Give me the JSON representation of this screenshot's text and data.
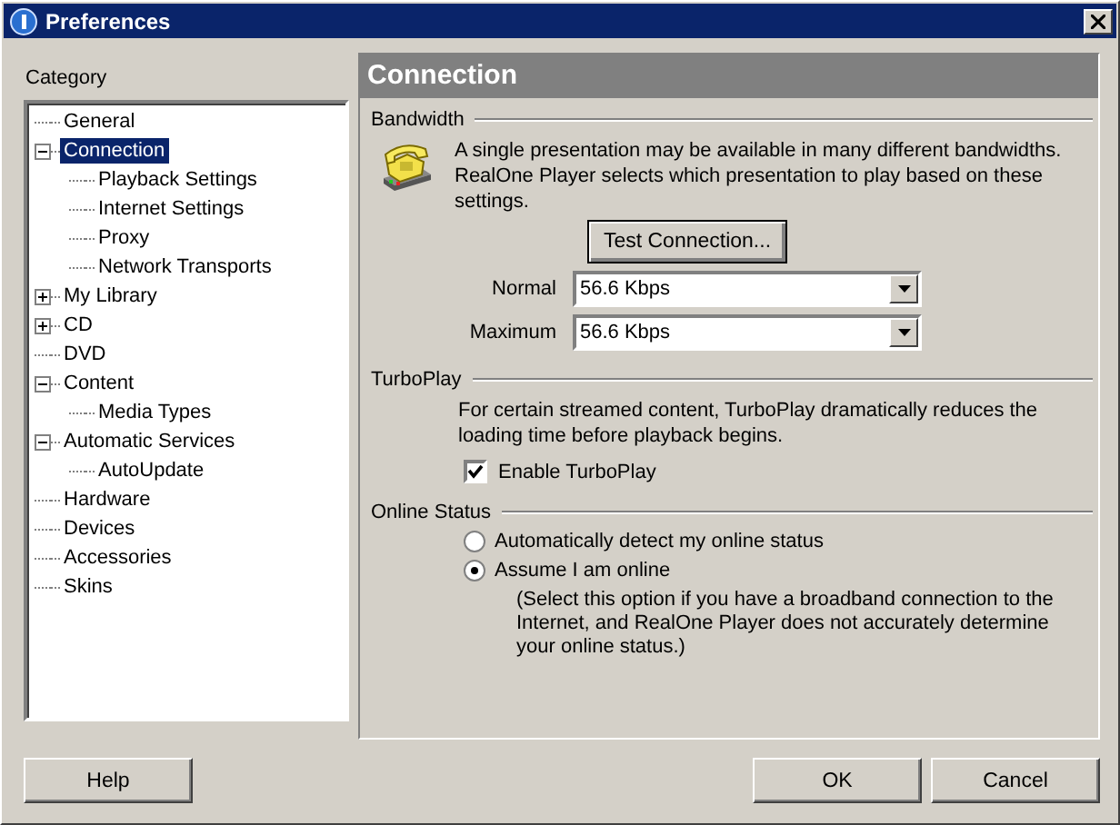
{
  "window": {
    "title": "Preferences"
  },
  "category_label": "Category",
  "tree": [
    {
      "label": "General",
      "selected": false
    },
    {
      "label": "Connection",
      "selected": true,
      "expanded": true,
      "children": [
        {
          "label": "Playback Settings",
          "selected": false
        },
        {
          "label": "Internet Settings",
          "selected": false
        },
        {
          "label": "Proxy",
          "selected": false
        },
        {
          "label": "Network Transports",
          "selected": false
        }
      ]
    },
    {
      "label": "My Library",
      "selected": false,
      "expanded": false
    },
    {
      "label": "CD",
      "selected": false,
      "expanded": false
    },
    {
      "label": "DVD",
      "selected": false
    },
    {
      "label": "Content",
      "selected": false,
      "expanded": true,
      "children": [
        {
          "label": "Media Types",
          "selected": false
        }
      ]
    },
    {
      "label": "Automatic Services",
      "selected": false,
      "expanded": true,
      "children": [
        {
          "label": "AutoUpdate",
          "selected": false
        }
      ]
    },
    {
      "label": "Hardware",
      "selected": false
    },
    {
      "label": "Devices",
      "selected": false
    },
    {
      "label": "Accessories",
      "selected": false
    },
    {
      "label": "Skins",
      "selected": false
    }
  ],
  "panel": {
    "title": "Connection",
    "bandwidth": {
      "heading": "Bandwidth",
      "description": "A single presentation may be available in many different bandwidths. RealOne Player selects which presentation to play based on these settings.",
      "test_button": "Test Connection...",
      "fields": [
        {
          "label": "Normal",
          "value": "56.6 Kbps"
        },
        {
          "label": "Maximum",
          "value": "56.6 Kbps"
        }
      ]
    },
    "turboplay": {
      "heading": "TurboPlay",
      "description": "For certain streamed content, TurboPlay dramatically reduces the loading time before playback begins.",
      "checkbox": {
        "label": "Enable TurboPlay",
        "checked": true
      }
    },
    "online_status": {
      "heading": "Online Status",
      "options": [
        {
          "label": "Automatically detect my online status",
          "selected": false
        },
        {
          "label": "Assume I am online",
          "selected": true
        }
      ],
      "note": "(Select this option if you have a broadband connection to the Internet, and RealOne Player does not accurately determine your online status.)"
    }
  },
  "buttons": [
    {
      "label": "Help",
      "kind": "left"
    },
    {
      "label": "OK",
      "kind": "right"
    },
    {
      "label": "Cancel",
      "kind": "right"
    }
  ]
}
